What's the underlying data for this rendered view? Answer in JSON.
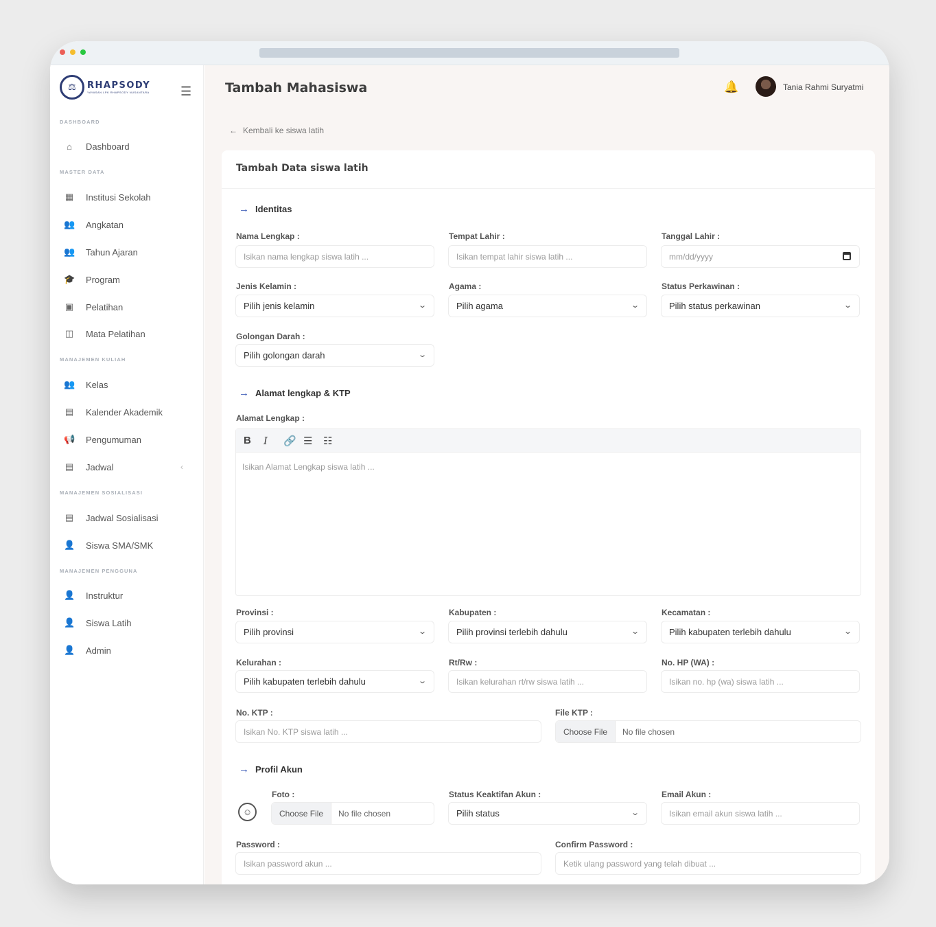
{
  "app": {
    "logo_main": "RHAPSODY",
    "logo_sub": "YAYASAN LPK RHAPSODY NUSANTARA"
  },
  "sidebar": {
    "sections": [
      {
        "title": "DASHBOARD",
        "items": [
          {
            "label": "Dashboard",
            "icon": "home-icon"
          }
        ]
      },
      {
        "title": "MASTER DATA",
        "items": [
          {
            "label": "Institusi Sekolah",
            "icon": "building-icon"
          },
          {
            "label": "Angkatan",
            "icon": "users-icon"
          },
          {
            "label": "Tahun Ajaran",
            "icon": "users-icon"
          },
          {
            "label": "Program",
            "icon": "graduation-cap-icon"
          },
          {
            "label": "Pelatihan",
            "icon": "book-icon"
          },
          {
            "label": "Mata Pelatihan",
            "icon": "open-book-icon"
          }
        ]
      },
      {
        "title": "MANAJEMEN KULIAH",
        "items": [
          {
            "label": "Kelas",
            "icon": "users-icon"
          },
          {
            "label": "Kalender Akademik",
            "icon": "calendar-icon"
          },
          {
            "label": "Pengumuman",
            "icon": "megaphone-icon"
          },
          {
            "label": "Jadwal",
            "icon": "calendar-icon"
          }
        ]
      },
      {
        "title": "MANAJEMEN SOSIALISASI",
        "items": [
          {
            "label": "Jadwal Sosialisasi",
            "icon": "calendar-icon"
          },
          {
            "label": "Siswa SMA/SMK",
            "icon": "user-icon"
          }
        ]
      },
      {
        "title": "MANAJEMEN PENGGUNA",
        "items": [
          {
            "label": "Instruktur",
            "icon": "user-icon"
          },
          {
            "label": "Siswa Latih",
            "icon": "user-icon"
          },
          {
            "label": "Admin",
            "icon": "user-icon"
          }
        ]
      }
    ]
  },
  "header": {
    "title": "Tambah Mahasiswa",
    "user_name": "Tania Rahmi Suryatmi"
  },
  "back_link": "Kembali ke siswa latih",
  "card_title": "Tambah Data siswa latih",
  "sections": {
    "identitas": "Identitas",
    "alamat": "Alamat lengkap & KTP",
    "profil": "Profil Akun"
  },
  "fields": {
    "nama": {
      "label": "Nama Lengkap :",
      "placeholder": "Isikan nama lengkap siswa latih ..."
    },
    "tempat_lahir": {
      "label": "Tempat Lahir :",
      "placeholder": "Isikan tempat lahir siswa latih ..."
    },
    "tanggal_lahir": {
      "label": "Tanggal Lahir :",
      "placeholder": "mm/dd/yyyy"
    },
    "jenis_kelamin": {
      "label": "Jenis Kelamin :",
      "value": "Pilih jenis kelamin"
    },
    "agama": {
      "label": "Agama :",
      "value": "Pilih agama"
    },
    "status_perkawinan": {
      "label": "Status Perkawinan :",
      "value": "Pilih status perkawinan"
    },
    "golongan_darah": {
      "label": "Golongan Darah :",
      "value": "Pilih golongan darah"
    },
    "alamat": {
      "label": "Alamat Lengkap :",
      "placeholder": "Isikan Alamat Lengkap siswa latih ..."
    },
    "provinsi": {
      "label": "Provinsi :",
      "value": "Pilih provinsi"
    },
    "kabupaten": {
      "label": "Kabupaten :",
      "value": "Pilih provinsi terlebih dahulu"
    },
    "kecamatan": {
      "label": "Kecamatan :",
      "value": "Pilih kabupaten terlebih dahulu"
    },
    "kelurahan": {
      "label": "Kelurahan :",
      "value": "Pilih kabupaten terlebih dahulu"
    },
    "rtrw": {
      "label": "Rt/Rw :",
      "placeholder": "Isikan kelurahan rt/rw siswa latih ..."
    },
    "nohp": {
      "label": "No. HP (WA) :",
      "placeholder": "Isikan no. hp (wa) siswa latih ..."
    },
    "noktp": {
      "label": "No. KTP :",
      "placeholder": "Isikan No. KTP siswa latih ..."
    },
    "file_ktp": {
      "label": "File KTP :",
      "button": "Choose File",
      "status": "No file chosen"
    },
    "foto": {
      "label": "Foto :",
      "button": "Choose File",
      "status": "No file chosen"
    },
    "status_akun": {
      "label": "Status Keaktifan Akun :",
      "value": "Pilih status"
    },
    "email": {
      "label": "Email Akun :",
      "placeholder": "Isikan email akun siswa latih ..."
    },
    "password": {
      "label": "Password :",
      "placeholder": "Isikan password akun ..."
    },
    "confirm": {
      "label": "Confirm Password :",
      "placeholder": "Ketik ulang password yang telah dibuat ..."
    }
  },
  "editor_tools": [
    "B",
    "I",
    "link-icon",
    "bullet-list-icon",
    "numbered-list-icon"
  ],
  "colors": {
    "accent": "#2d4fb2",
    "brand": "#2d3c74",
    "main_bg": "#f9f5f3"
  }
}
